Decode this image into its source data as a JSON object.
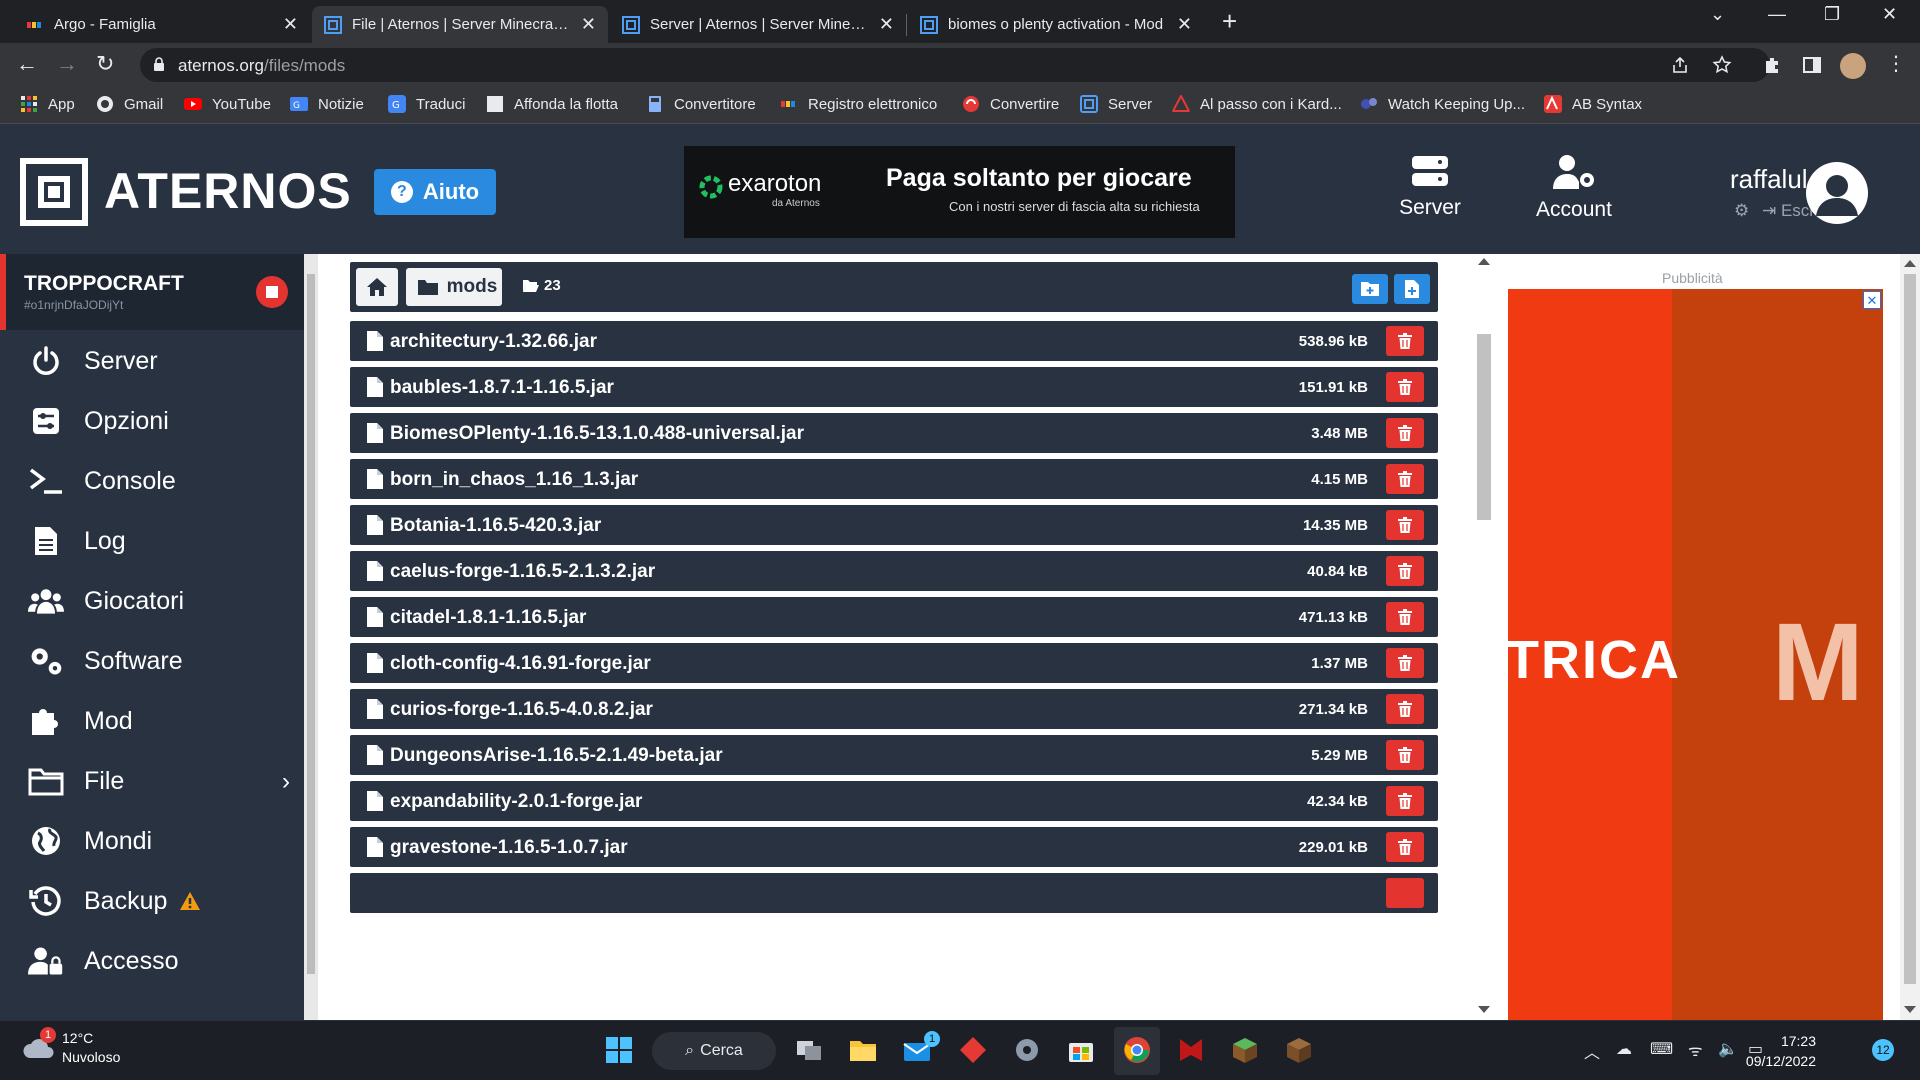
{
  "browser": {
    "tabs": [
      {
        "title": "Argo - Famiglia"
      },
      {
        "title": "File | Aternos | Server Minecraft g"
      },
      {
        "title": "Server | Aternos | Server Minecraf"
      },
      {
        "title": "biomes o plenty activation - Mod"
      }
    ],
    "url_host": "aternos.org",
    "url_path": "/files/mods",
    "bookmarks": [
      "App",
      "Gmail",
      "YouTube",
      "Notizie",
      "Traduci",
      "Affonda la flotta",
      "Convertitore",
      "Registro elettronico",
      "Convertire",
      "Server",
      "Al passo con i Kard...",
      "Watch Keeping Up...",
      "AB Syntax"
    ]
  },
  "header": {
    "logo": "ATERNOS",
    "help_label": "Aiuto",
    "promo_brand": "exaroton",
    "promo_brand_sub": "da Aternos",
    "promo_title": "Paga soltanto per giocare",
    "promo_sub": "Con i nostri server di fascia alta su richiesta",
    "nav_server": "Server",
    "nav_account": "Account",
    "username": "raffalul",
    "logout": "Esci"
  },
  "sidebar": {
    "server_name": "TROPPOCRAFT",
    "server_id": "#o1nrjnDfaJODijYt",
    "items": [
      {
        "label": "Server",
        "icon": "power-icon"
      },
      {
        "label": "Opzioni",
        "icon": "sliders-icon"
      },
      {
        "label": "Console",
        "icon": "terminal-icon"
      },
      {
        "label": "Log",
        "icon": "document-icon"
      },
      {
        "label": "Giocatori",
        "icon": "users-icon"
      },
      {
        "label": "Software",
        "icon": "gears-icon"
      },
      {
        "label": "Mod",
        "icon": "puzzle-icon"
      },
      {
        "label": "File",
        "icon": "folder-icon"
      },
      {
        "label": "Mondi",
        "icon": "globe-icon"
      },
      {
        "label": "Backup",
        "icon": "history-icon"
      },
      {
        "label": "Accesso",
        "icon": "user-lock-icon"
      }
    ]
  },
  "files": {
    "folder": "mods",
    "count": "23",
    "items": [
      {
        "name": "architectury-1.32.66.jar",
        "size": "538.96 kB"
      },
      {
        "name": "baubles-1.8.7.1-1.16.5.jar",
        "size": "151.91 kB"
      },
      {
        "name": "BiomesOPlenty-1.16.5-13.1.0.488-universal.jar",
        "size": "3.48 MB"
      },
      {
        "name": "born_in_chaos_1.16_1.3.jar",
        "size": "4.15 MB"
      },
      {
        "name": "Botania-1.16.5-420.3.jar",
        "size": "14.35 MB"
      },
      {
        "name": "caelus-forge-1.16.5-2.1.3.2.jar",
        "size": "40.84 kB"
      },
      {
        "name": "citadel-1.8.1-1.16.5.jar",
        "size": "471.13 kB"
      },
      {
        "name": "cloth-config-4.16.91-forge.jar",
        "size": "1.37 MB"
      },
      {
        "name": "curios-forge-1.16.5-4.0.8.2.jar",
        "size": "271.34 kB"
      },
      {
        "name": "DungeonsArise-1.16.5-2.1.49-beta.jar",
        "size": "5.29 MB"
      },
      {
        "name": "expandability-2.0.1-forge.jar",
        "size": "42.34 kB"
      },
      {
        "name": "gravestone-1.16.5-1.0.7.jar",
        "size": "229.01 kB"
      }
    ]
  },
  "ad": {
    "label": "Pubblicità",
    "text_left": "TRICA",
    "text_right": "M"
  },
  "taskbar": {
    "temp": "12°C",
    "weather": "Nuvoloso",
    "weather_badge": "1",
    "search": "Cerca",
    "mail_badge": "1",
    "time": "17:23",
    "date": "09/12/2022",
    "notifications": "12"
  }
}
